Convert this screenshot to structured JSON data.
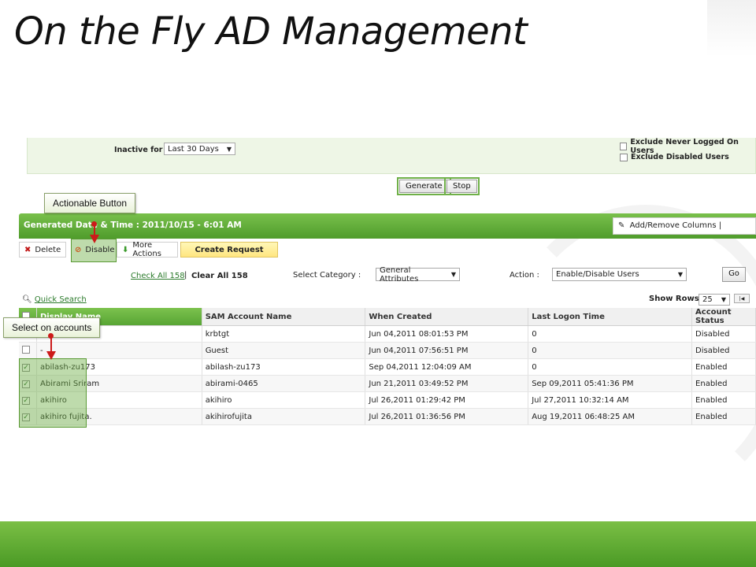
{
  "slide": {
    "title": "On the Fly AD Management"
  },
  "filter": {
    "inactive_label": "Inactive for :",
    "inactive_value": "Last 30 Days",
    "exclude_never_logged": "Exclude Never Logged On Users",
    "exclude_disabled": "Exclude Disabled Users",
    "generate_label": "Generate",
    "stop_label": "Stop"
  },
  "report": {
    "generated": "Generated Date & Time : 2011/10/15 - 6:01 AM",
    "add_remove_columns": "Add/Remove Columns |"
  },
  "toolbar": {
    "delete_label": "Delete",
    "disable_label": "Disable",
    "more_actions_label": "More Actions",
    "create_request_label": "Create Request"
  },
  "category": {
    "check_all": "Check All 158",
    "separator": "|",
    "clear_all": "Clear All 158",
    "select_category_label": "Select Category :",
    "category_value": "General Attributes",
    "action_label": "Action :",
    "action_value": "Enable/Disable Users",
    "go_label": "Go"
  },
  "quick_search": "Quick Search",
  "show_rows": {
    "label": "Show Rows :",
    "value": "25"
  },
  "table": {
    "columns": [
      "Display Name",
      "SAM Account Name",
      "When Created",
      "Last Logon Time",
      "Account Status"
    ],
    "rows": [
      {
        "checked": false,
        "display": "",
        "sam": "krbtgt",
        "created": "Jun 04,2011 08:01:53 PM",
        "logon": "0",
        "status": "Disabled"
      },
      {
        "checked": false,
        "display": "-",
        "sam": "Guest",
        "created": "Jun 04,2011 07:56:51 PM",
        "logon": "0",
        "status": "Disabled"
      },
      {
        "checked": true,
        "display": "abilash-zu173",
        "sam": "abilash-zu173",
        "created": "Sep 04,2011 12:04:09 AM",
        "logon": "0",
        "status": "Enabled"
      },
      {
        "checked": true,
        "display": "Abirami Sriram",
        "sam": "abirami-0465",
        "created": "Jun 21,2011 03:49:52 PM",
        "logon": "Sep 09,2011 05:41:36 PM",
        "status": "Enabled"
      },
      {
        "checked": true,
        "display": "akihiro",
        "sam": "akihiro",
        "created": "Jul 26,2011 01:29:42 PM",
        "logon": "Jul 27,2011 10:32:14 AM",
        "status": "Enabled"
      },
      {
        "checked": true,
        "display": "akihiro fujita.",
        "sam": "akihirofujita",
        "created": "Jul 26,2011 01:36:56 PM",
        "logon": "Aug 19,2011 06:48:25 AM",
        "status": "Enabled"
      }
    ]
  },
  "callouts": {
    "actionable_button": "Actionable Button",
    "select_accounts": "Select on accounts"
  },
  "icons": {
    "delete": "x-icon",
    "disable": "ban-icon",
    "more_actions": "arrow-down-icon",
    "add_remove": "edit-icon",
    "search": "search-icon"
  },
  "colors": {
    "brand_green": "#5aa832",
    "callout_arrow": "#cc1a1a"
  }
}
